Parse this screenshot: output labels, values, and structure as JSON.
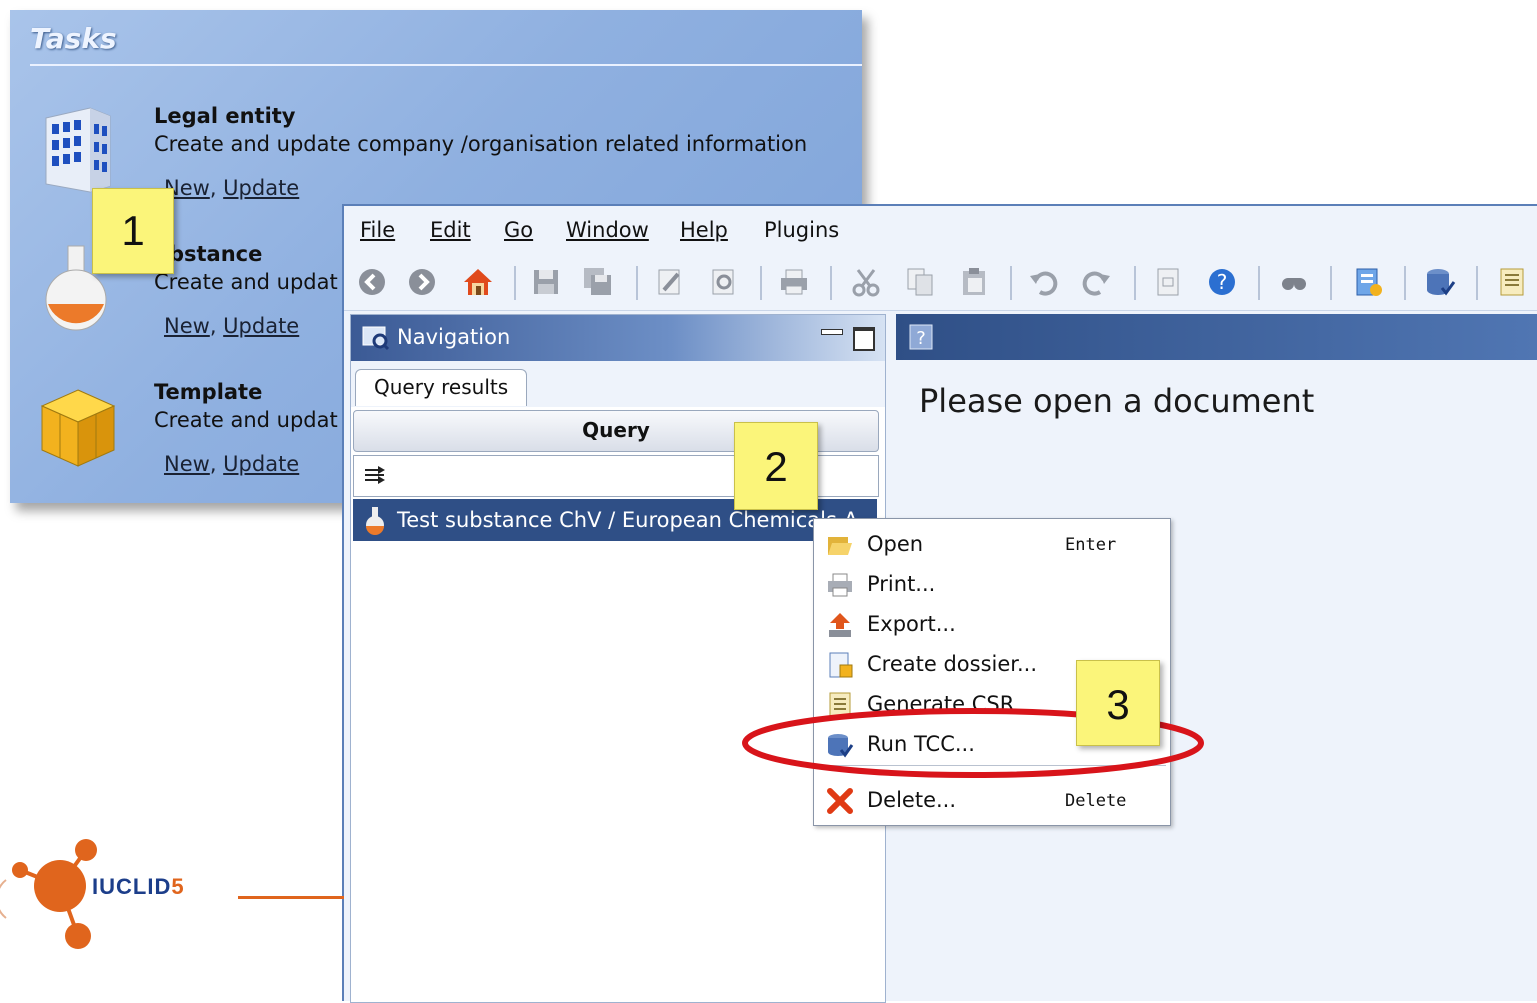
{
  "tasks": {
    "title": "Tasks",
    "items": [
      {
        "title": "Legal entity",
        "description": "Create and update company /organisation related information",
        "link_new": "New",
        "link_update": "Update"
      },
      {
        "title": "ubstance",
        "description": "Create and updat",
        "link_new": "New",
        "link_update": "Update"
      },
      {
        "title": "Template",
        "description": "Create and updat",
        "link_new": "New",
        "link_update": "Update"
      }
    ]
  },
  "menubar": {
    "file": "File",
    "edit": "Edit",
    "go": "Go",
    "window": "Window",
    "help": "Help",
    "plugins": "Plugins"
  },
  "navigation": {
    "title": "Navigation",
    "tab": "Query results",
    "query_label": "Query",
    "result": "Test substance ChV / European Chemicals A"
  },
  "document": {
    "message": "Please open a document"
  },
  "context_menu": {
    "items": [
      {
        "label": "Open",
        "shortcut": "Enter",
        "icon": "folder-open-icon"
      },
      {
        "label": "Print...",
        "shortcut": "",
        "icon": "printer-icon"
      },
      {
        "label": "Export...",
        "shortcut": "",
        "icon": "export-icon"
      },
      {
        "label": "Create dossier...",
        "shortcut": "",
        "icon": "dossier-icon"
      },
      {
        "label": "Generate CSR",
        "shortcut": "",
        "icon": "report-icon"
      },
      {
        "label": "Run TCC...",
        "shortcut": "",
        "icon": "database-check-icon"
      },
      {
        "label": "Delete...",
        "shortcut": "Delete",
        "icon": "delete-x-icon"
      }
    ]
  },
  "callouts": [
    "1",
    "2",
    "3"
  ],
  "logo": {
    "name": "IUCLID",
    "version": "5"
  },
  "colors": {
    "highlight_ellipse": "#d8141a",
    "note": "#fbf57a",
    "selection": "#2f4f86"
  }
}
